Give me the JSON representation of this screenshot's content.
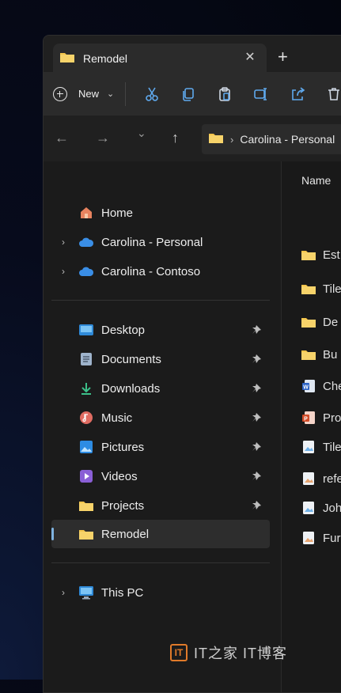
{
  "tab": {
    "title": "Remodel",
    "close_glyph": "✕",
    "new_tab_glyph": "+"
  },
  "toolbar": {
    "new_label": "New",
    "icons": [
      "cut-icon",
      "copy-icon",
      "paste-icon",
      "rename-icon",
      "share-icon",
      "delete-icon"
    ]
  },
  "nav": {
    "back": "←",
    "forward": "→",
    "recent": "⌄",
    "up": "↑",
    "address_text": "Carolina - Personal"
  },
  "sidebar": {
    "home": "Home",
    "cloud1": "Carolina - Personal",
    "cloud2": "Carolina - Contoso",
    "desktop": "Desktop",
    "documents": "Documents",
    "downloads": "Downloads",
    "music": "Music",
    "pictures": "Pictures",
    "videos": "Videos",
    "projects": "Projects",
    "remodel": "Remodel",
    "thispc": "This PC"
  },
  "content": {
    "col_name": "Name",
    "files": [
      {
        "name": "Est",
        "icon": "folder"
      },
      {
        "name": "Tile",
        "icon": "folder"
      },
      {
        "name": "De",
        "icon": "folder"
      },
      {
        "name": "Bu",
        "icon": "folder"
      },
      {
        "name": "Che",
        "icon": "word-doc"
      },
      {
        "name": "Pro",
        "icon": "powerpoint"
      },
      {
        "name": "Tile",
        "icon": "image-file"
      },
      {
        "name": "refe",
        "icon": "image-file"
      },
      {
        "name": "Joh",
        "icon": "image-file"
      },
      {
        "name": "Fur",
        "icon": "image-file"
      }
    ]
  },
  "watermark": {
    "text": "IT之家 IT博客"
  },
  "colors": {
    "accent": "#7fb3e0",
    "folder": "#f3c44b",
    "cloud": "#3a8ee6",
    "watermark": "#e07a2a"
  }
}
